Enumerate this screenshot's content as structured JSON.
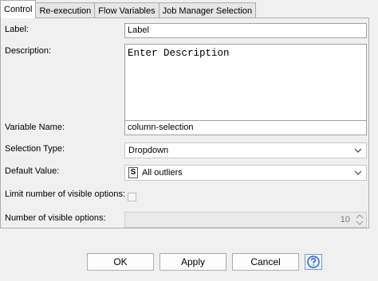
{
  "tabs": [
    "Control",
    "Re-execution",
    "Flow Variables",
    "Job Manager Selection"
  ],
  "form": {
    "label_caption": "Label:",
    "label_value": "Label",
    "description_caption": "Description:",
    "description_value": "Enter Description",
    "variable_name_caption": "Variable Name:",
    "variable_name_value": "column-selection",
    "selection_type_caption": "Selection Type:",
    "selection_type_value": "Dropdown",
    "default_value_caption": "Default Value:",
    "default_value_badge": "S",
    "default_value_value": "All outliers",
    "limit_options_caption": "Limit number of visible options:",
    "limit_options_checked": false,
    "visible_options_caption": "Number of visible options:",
    "visible_options_value": "10"
  },
  "buttons": {
    "ok": "OK",
    "apply": "Apply",
    "cancel": "Cancel"
  },
  "icons": {
    "help": "help-icon",
    "dropdown": "chevron-down-icon",
    "spinner": "spinner-arrows-icon"
  },
  "colors": {
    "help_accent": "#1c63d0",
    "panel_bg": "#f0f0f0",
    "border": "#adadad"
  }
}
